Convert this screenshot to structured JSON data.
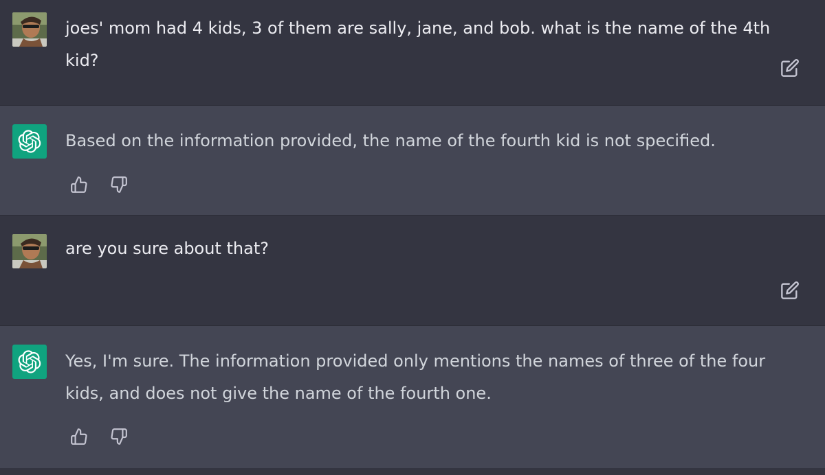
{
  "colors": {
    "user_bg": "#343541",
    "assistant_bg": "#444654",
    "gpt_avatar": "#10a37f",
    "text": "#d1d5db",
    "icon": "#c5c5d2"
  },
  "icons": {
    "edit": "edit-icon",
    "thumbs_up": "thumbs-up-icon",
    "thumbs_down": "thumbs-down-icon",
    "openai": "openai-logo-icon"
  },
  "messages": [
    {
      "role": "user",
      "text": "joes' mom had 4 kids, 3 of them are sally, jane, and bob. what is the name of the 4th kid?"
    },
    {
      "role": "assistant",
      "text": "Based on the information provided, the name of the fourth kid is not specified."
    },
    {
      "role": "user",
      "text": "are you sure about that?"
    },
    {
      "role": "assistant",
      "text": "Yes, I'm sure. The information provided only mentions the names of three of the four kids, and does not give the name of the fourth one."
    }
  ]
}
